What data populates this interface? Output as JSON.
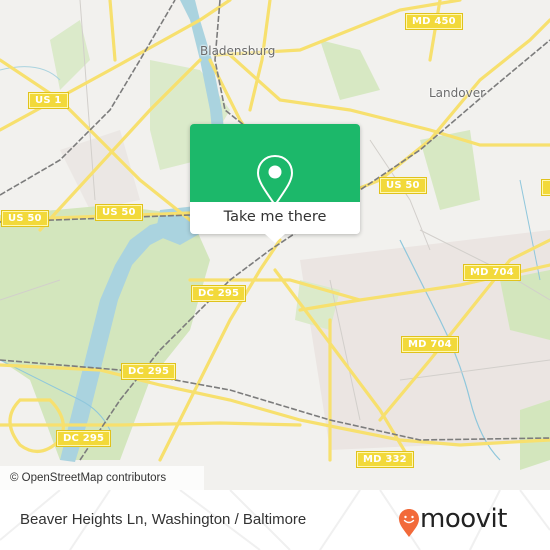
{
  "map": {
    "place_labels": [
      {
        "id": "bladensburg",
        "text": "Bladensburg"
      },
      {
        "id": "landover",
        "text": "Landover"
      }
    ],
    "route_shields": [
      {
        "id": "md450",
        "text": "MD 450"
      },
      {
        "id": "us1",
        "text": "US 1"
      },
      {
        "id": "us50-west",
        "text": "US 50"
      },
      {
        "id": "us50-mid",
        "text": "US 50"
      },
      {
        "id": "us50-east",
        "text": "US 50"
      },
      {
        "id": "dc295-north",
        "text": "DC 295"
      },
      {
        "id": "dc295-mid",
        "text": "DC 295"
      },
      {
        "id": "dc295-south",
        "text": "DC 295"
      },
      {
        "id": "md704-north",
        "text": "MD 704"
      },
      {
        "id": "md704-south",
        "text": "MD 704"
      },
      {
        "id": "md332",
        "text": "MD 332"
      }
    ],
    "attribution": "© OpenStreetMap contributors",
    "colors": {
      "land": "#f2f1ee",
      "park": "#cfe5b4",
      "water": "#aad3df",
      "road_major": "#f7e06e",
      "rail": "#777777"
    }
  },
  "popup": {
    "icon": "map-pin-icon",
    "action_label": "Take me there",
    "accent_color": "#1cb86a"
  },
  "footer": {
    "address": "Beaver Heights Ln, Washington / Baltimore",
    "brand": "moovit",
    "brand_color": "#f26a3a"
  }
}
